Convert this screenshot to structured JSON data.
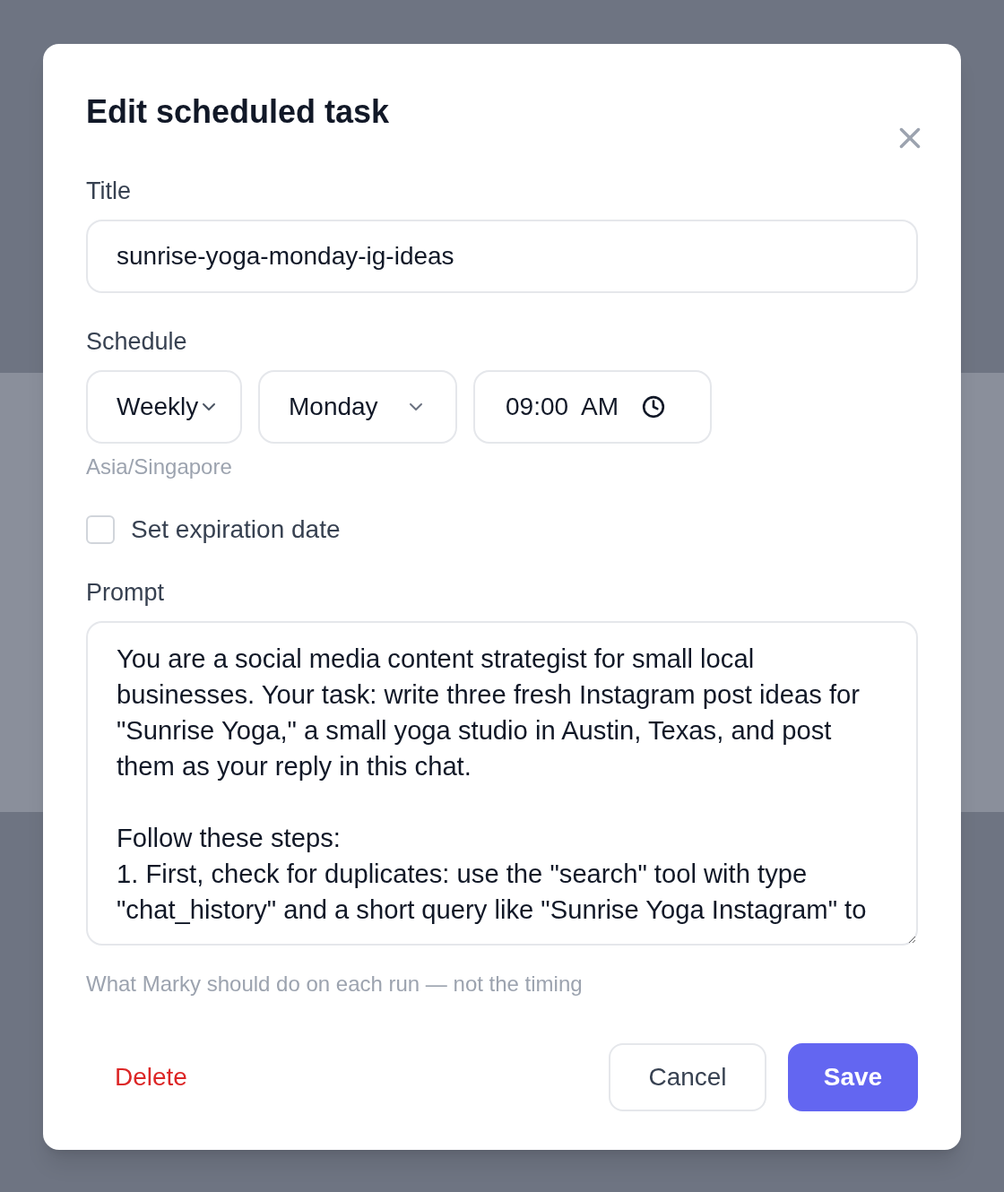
{
  "dialog": {
    "title": "Edit scheduled task",
    "title_field": {
      "label": "Title",
      "value": "sunrise-yoga-monday-ig-ideas"
    },
    "schedule": {
      "label": "Schedule",
      "frequency": "Weekly",
      "day": "Monday",
      "time": "09:00  AM",
      "timezone": "Asia/Singapore"
    },
    "expiration": {
      "label": "Set expiration date",
      "checked": false
    },
    "prompt": {
      "label": "Prompt",
      "value": "You are a social media content strategist for small local businesses. Your task: write three fresh Instagram post ideas for \"Sunrise Yoga,\" a small yoga studio in Austin, Texas, and post them as your reply in this chat.\n\nFollow these steps:\n1. First, check for duplicates: use the \"search\" tool with type \"chat_history\" and a short query like \"Sunrise Yoga Instagram\" to",
      "hint": "What Marky should do on each run — not the timing"
    },
    "buttons": {
      "delete": "Delete",
      "cancel": "Cancel",
      "save": "Save"
    }
  }
}
